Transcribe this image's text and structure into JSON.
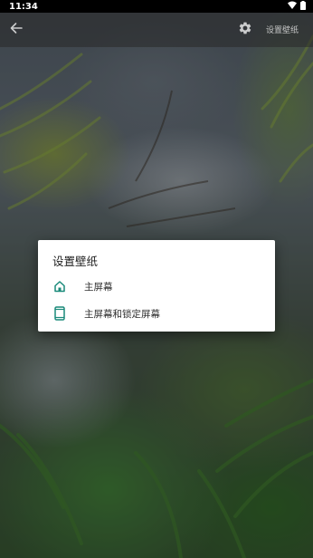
{
  "status_bar": {
    "time": "11:34",
    "icons": [
      "wifi-icon",
      "battery-icon"
    ]
  },
  "toolbar": {
    "back_icon": "back-arrow-icon",
    "settings_icon": "gear-icon",
    "set_wallpaper_label": "设置壁纸"
  },
  "dialog": {
    "title": "设置壁纸",
    "options": [
      {
        "label": "主屏幕",
        "icon": "home-icon"
      },
      {
        "label": "主屏幕和锁定屏幕",
        "icon": "phone-icon"
      }
    ],
    "accent_color": "#1a8a7a"
  }
}
